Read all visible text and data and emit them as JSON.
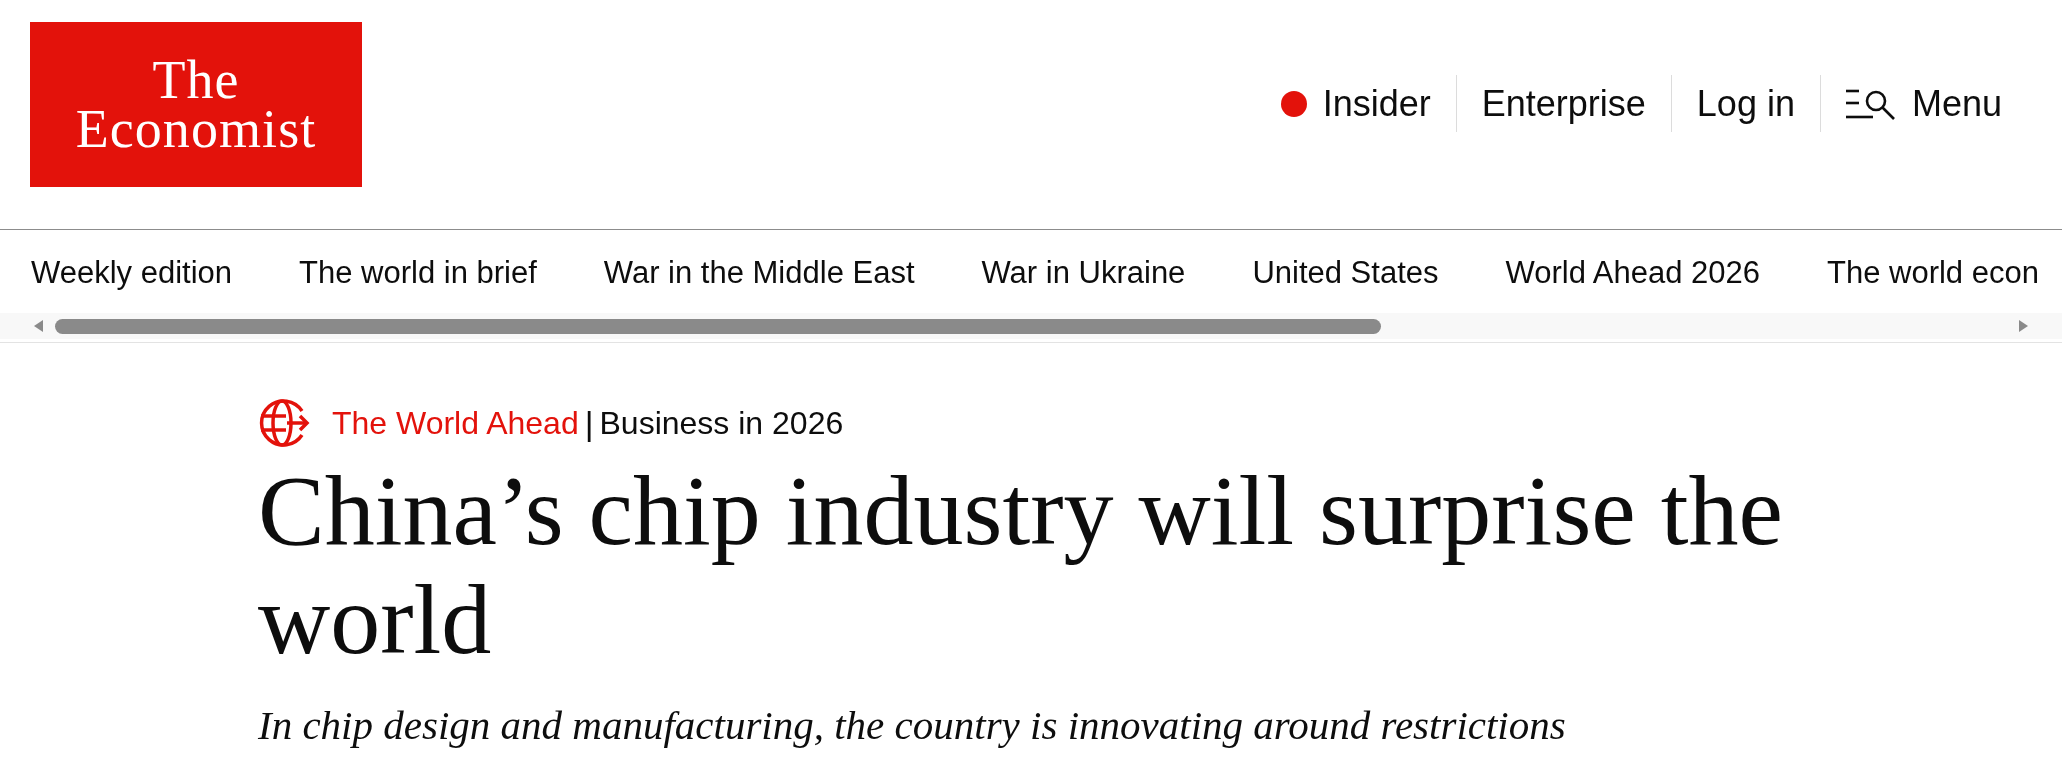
{
  "logo": {
    "lines": [
      "The",
      "Economist"
    ]
  },
  "header_links": [
    {
      "kind": "insider",
      "label": "Insider"
    },
    {
      "kind": "link",
      "label": "Enterprise"
    },
    {
      "kind": "link",
      "label": "Log in"
    },
    {
      "kind": "menu",
      "label": "Menu"
    }
  ],
  "nav_tabs": [
    "Weekly edition",
    "The world in brief",
    "War in the Middle East",
    "War in Ukraine",
    "United States",
    "World Ahead 2026",
    "The world econ"
  ],
  "article": {
    "kicker": {
      "section": "The World Ahead",
      "separator": "|",
      "topic": "Business in 2026"
    },
    "headline": "China’s chip industry will surprise the world",
    "standfirst": "In chip design and manufacturing, the country is innovating around restrictions"
  }
}
